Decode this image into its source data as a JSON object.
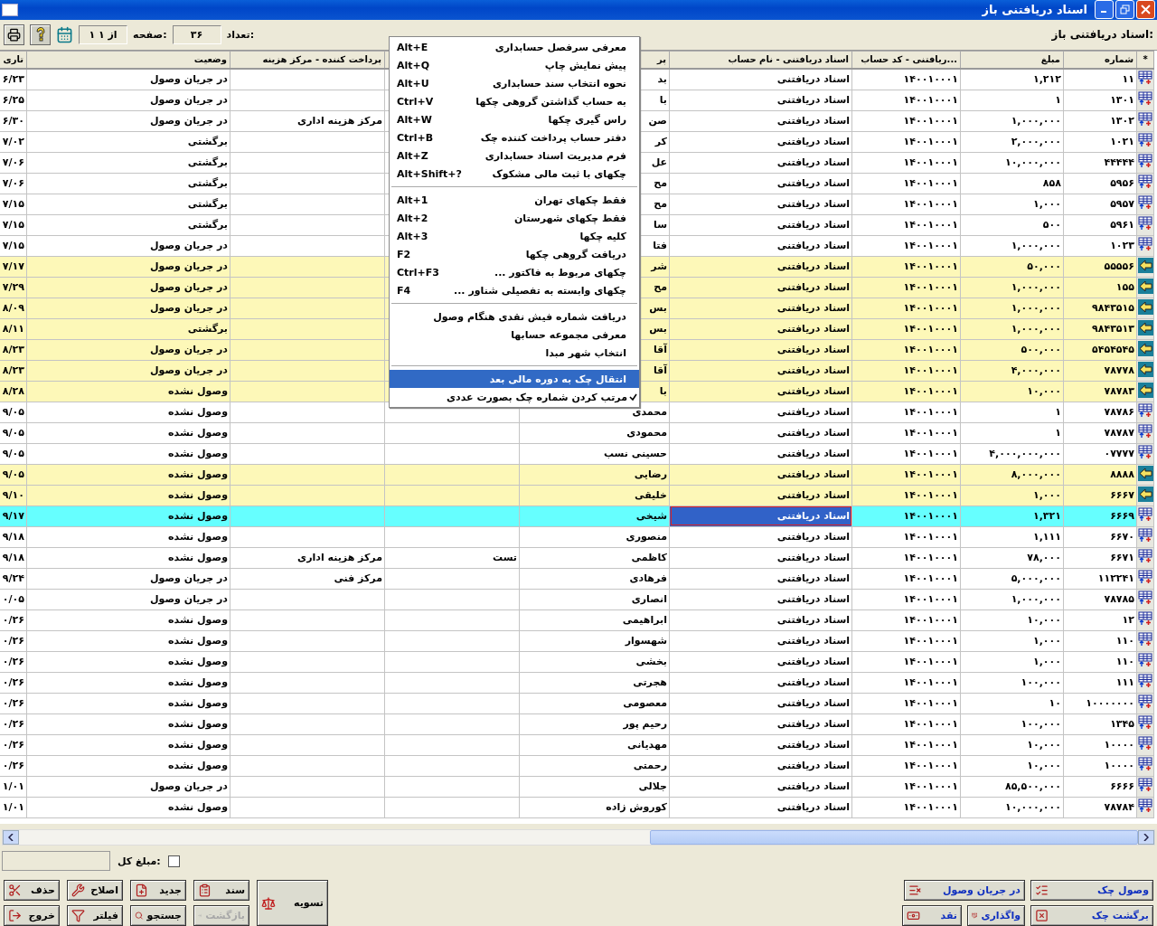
{
  "window": {
    "title": "اسناد دریافتنی باز"
  },
  "toolbar": {
    "heading": "اسناد دریافتنی باز:",
    "count_label": "تعداد:",
    "count": "۳۶",
    "page_label": "صفحه:",
    "page": "۱ از ۱"
  },
  "table": {
    "columns": [
      "*",
      "شماره",
      "مبلغ",
      "...ریافتنی - کد حساب",
      "اسناد دریافتنی - نام حساب",
      "پر",
      null,
      "پرداخت کننده - مرکز هزینه",
      "وضعیت",
      "تاری"
    ],
    "rows": [
      {
        "kind": "sheet",
        "selected": false,
        "number": "۱۱",
        "amount": "۱,۲۱۲",
        "account_code": "۱۴۰۰۱۰۰۰۱",
        "account_name": "اسناد دریافتنی",
        "column_5": "بد",
        "status": "در جریان وصول",
        "column_10": "۶/۲۳"
      },
      {
        "kind": "sheet",
        "selected": false,
        "number": "۱۳۰۱",
        "amount": "۱",
        "account_code": "۱۴۰۰۱۰۰۰۱",
        "account_name": "اسناد دریافتنی",
        "column_5": "با",
        "status": "در جریان وصول",
        "column_10": "۶/۲۵"
      },
      {
        "kind": "sheet",
        "selected": false,
        "number": "۱۳۰۲",
        "amount": "۱,۰۰۰,۰۰۰",
        "account_code": "۱۴۰۰۱۰۰۰۱",
        "account_name": "اسناد دریافتنی",
        "column_5": "صن",
        "cost_center": "مرکز هزینه اداری",
        "status": "در جریان وصول",
        "column_10": "۶/۳۰"
      },
      {
        "kind": "sheet",
        "selected": false,
        "number": "۱۰۲۱",
        "amount": "۲,۰۰۰,۰۰۰",
        "account_code": "۱۴۰۰۱۰۰۰۱",
        "account_name": "اسناد دریافتنی",
        "column_5": "کر",
        "status": "برگشتی",
        "column_10": "۷/۰۲"
      },
      {
        "kind": "sheet",
        "selected": false,
        "number": "۴۴۴۴۴",
        "amount": "۱۰,۰۰۰,۰۰۰",
        "account_code": "۱۴۰۰۱۰۰۰۱",
        "account_name": "اسناد دریافتنی",
        "column_5": "عل",
        "status": "برگشتی",
        "column_10": "۷/۰۶"
      },
      {
        "kind": "sheet",
        "selected": false,
        "number": "۵۹۵۶",
        "amount": "۸۵۸",
        "account_code": "۱۴۰۰۱۰۰۰۱",
        "account_name": "اسناد دریافتنی",
        "column_5": "مح",
        "status": "برگشتی",
        "column_10": "۷/۰۶"
      },
      {
        "kind": "sheet",
        "selected": false,
        "number": "۵۹۵۷",
        "amount": "۱,۰۰۰",
        "account_code": "۱۴۰۰۱۰۰۰۱",
        "account_name": "اسناد دریافتنی",
        "column_5": "مح",
        "status": "برگشتی",
        "column_10": "۷/۱۵"
      },
      {
        "kind": "sheet",
        "selected": false,
        "number": "۵۹۶۱",
        "amount": "۵۰۰",
        "account_code": "۱۴۰۰۱۰۰۰۱",
        "account_name": "اسناد دریافتنی",
        "column_5": "سا",
        "status": "برگشتی",
        "column_10": "۷/۱۵"
      },
      {
        "kind": "sheet",
        "selected": false,
        "number": "۱۰۲۳",
        "amount": "۱,۰۰۰,۰۰۰",
        "account_code": "۱۴۰۰۱۰۰۰۱",
        "account_name": "اسناد دریافتنی",
        "column_5": "فتا",
        "status": "در جریان وصول",
        "column_10": "۷/۱۵"
      },
      {
        "kind": "arrow",
        "selected": false,
        "number": "۵۵۵۵۶",
        "amount": "۵۰,۰۰۰",
        "account_code": "۱۴۰۰۱۰۰۰۱",
        "account_name": "اسناد دریافتنی",
        "column_5": "شر",
        "status": "در جریان وصول",
        "column_10": "۷/۱۷"
      },
      {
        "kind": "arrow",
        "selected": false,
        "number": "۱۵۵",
        "amount": "۱,۰۰۰,۰۰۰",
        "account_code": "۱۴۰۰۱۰۰۰۱",
        "account_name": "اسناد دریافتنی",
        "column_5": "مح",
        "status": "در جریان وصول",
        "column_10": "۷/۲۹"
      },
      {
        "kind": "arrow",
        "selected": false,
        "number": "۹۸۴۳۵۱۵",
        "amount": "۱,۰۰۰,۰۰۰",
        "account_code": "۱۴۰۰۱۰۰۰۱",
        "account_name": "اسناد دریافتنی",
        "column_5": "بس",
        "status": "در جریان وصول",
        "column_10": "۸/۰۹"
      },
      {
        "kind": "arrow",
        "selected": false,
        "number": "۹۸۴۳۵۱۳",
        "amount": "۱,۰۰۰,۰۰۰",
        "account_code": "۱۴۰۰۱۰۰۰۱",
        "account_name": "اسناد دریافتنی",
        "column_5": "بس",
        "status": "برگشتی",
        "column_10": "۸/۱۱"
      },
      {
        "kind": "arrow",
        "selected": false,
        "number": "۵۴۵۴۵۴۵",
        "amount": "۵۰۰,۰۰۰",
        "account_code": "۱۴۰۰۱۰۰۰۱",
        "account_name": "اسناد دریافتنی",
        "column_5": "آقا",
        "status": "در جریان وصول",
        "column_10": "۸/۲۳"
      },
      {
        "kind": "arrow",
        "selected": false,
        "number": "۷۸۷۷۸",
        "amount": "۴,۰۰۰,۰۰۰",
        "account_code": "۱۴۰۰۱۰۰۰۱",
        "account_name": "اسناد دریافتنی",
        "column_5": "آقا",
        "status": "در جریان وصول",
        "column_10": "۸/۲۳"
      },
      {
        "kind": "arrow",
        "selected": false,
        "number": "۷۸۷۸۳",
        "amount": "۱۰,۰۰۰",
        "account_code": "۱۴۰۰۱۰۰۰۱",
        "account_name": "اسناد دریافتنی",
        "column_5": "با",
        "status": "وصول نشده",
        "column_10": "۸/۲۸"
      },
      {
        "kind": "sheet",
        "selected": false,
        "number": "۷۸۷۸۶",
        "amount": "۱",
        "account_code": "۱۴۰۰۱۰۰۰۱",
        "account_name": "اسناد دریافتنی",
        "column_5": "محمدی",
        "status": "وصول نشده",
        "column_10": "۹/۰۵"
      },
      {
        "kind": "sheet",
        "selected": false,
        "number": "۷۸۷۸۷",
        "amount": "۱",
        "account_code": "۱۴۰۰۱۰۰۰۱",
        "account_name": "اسناد دریافتنی",
        "column_5": "محمودی",
        "status": "وصول نشده",
        "column_10": "۹/۰۵"
      },
      {
        "kind": "sheet",
        "selected": false,
        "number": "۰۷۷۷۷",
        "amount": "۴,۰۰۰,۰۰۰,۰۰۰",
        "account_code": "۱۴۰۰۱۰۰۰۱",
        "account_name": "اسناد دریافتنی",
        "column_5": "حسینی نسب",
        "status": "وصول نشده",
        "column_10": "۹/۰۵"
      },
      {
        "kind": "arrow",
        "selected": false,
        "number": "۸۸۸۸",
        "amount": "۸,۰۰۰,۰۰۰",
        "account_code": "۱۴۰۰۱۰۰۰۱",
        "account_name": "اسناد دریافتنی",
        "column_5": "رضایی",
        "status": "وصول نشده",
        "column_10": "۹/۰۵"
      },
      {
        "kind": "arrow",
        "selected": false,
        "number": "۶۶۶۷",
        "amount": "۱,۰۰۰",
        "account_code": "۱۴۰۰۱۰۰۰۱",
        "account_name": "اسناد دریافتنی",
        "column_5": "خلیقی",
        "status": "وصول نشده",
        "column_10": "۹/۱۰"
      },
      {
        "kind": "sheet",
        "selected": true,
        "cell_focused": true,
        "number": "۶۶۶۹",
        "amount": "۱,۳۲۱",
        "account_code": "۱۴۰۰۱۰۰۰۱",
        "account_name": "اسناد دریافتنی",
        "column_5": "شیخی",
        "status": "وصول نشده",
        "column_10": "۹/۱۷"
      },
      {
        "kind": "sheet",
        "selected": false,
        "number": "۶۶۷۰",
        "amount": "۱,۱۱۱",
        "account_code": "۱۴۰۰۱۰۰۰۱",
        "account_name": "اسناد دریافتنی",
        "column_5": "منصوری",
        "status": "وصول نشده",
        "column_10": "۹/۱۸"
      },
      {
        "kind": "sheet",
        "selected": false,
        "number": "۶۶۷۱",
        "amount": "۷۸,۰۰۰",
        "account_code": "۱۴۰۰۱۰۰۰۱",
        "account_name": "اسناد دریافتنی",
        "column_5": "کاظمی",
        "column_6": "تست",
        "cost_center": "مرکز هزینه اداری",
        "status": "وصول نشده",
        "column_10": "۹/۱۸"
      },
      {
        "kind": "sheet",
        "selected": false,
        "number": "۱۱۲۲۴۱",
        "amount": "۵,۰۰۰,۰۰۰",
        "account_code": "۱۴۰۰۱۰۰۰۱",
        "account_name": "اسناد دریافتنی",
        "column_5": "فرهادی",
        "cost_center": "مرکز فنی",
        "status": "در جریان وصول",
        "column_10": "۹/۲۴"
      },
      {
        "kind": "sheet",
        "selected": false,
        "number": "۷۸۷۸۵",
        "amount": "۱,۰۰۰,۰۰۰",
        "account_code": "۱۴۰۰۱۰۰۰۱",
        "account_name": "اسناد دریافتنی",
        "column_5": "انصاری",
        "status": "در جریان وصول",
        "column_10": "۰/۰۵"
      },
      {
        "kind": "sheet",
        "selected": false,
        "number": "۱۲",
        "amount": "۱۰,۰۰۰",
        "account_code": "۱۴۰۰۱۰۰۰۱",
        "account_name": "اسناد دریافتنی",
        "column_5": "ابراهیمی",
        "status": "وصول نشده",
        "column_10": "۰/۲۶"
      },
      {
        "kind": "sheet",
        "selected": false,
        "number": "۱۱۰",
        "amount": "۱,۰۰۰",
        "account_code": "۱۴۰۰۱۰۰۰۱",
        "account_name": "اسناد دریافتنی",
        "column_5": "شهسوار",
        "status": "وصول نشده",
        "column_10": "۰/۲۶"
      },
      {
        "kind": "sheet",
        "selected": false,
        "number": "۱۱۰",
        "amount": "۱,۰۰۰",
        "account_code": "۱۴۰۰۱۰۰۰۱",
        "account_name": "اسناد دریافتنی",
        "column_5": "بخشی",
        "status": "وصول نشده",
        "column_10": "۰/۲۶"
      },
      {
        "kind": "sheet",
        "selected": false,
        "number": "۱۱۱",
        "amount": "۱۰۰,۰۰۰",
        "account_code": "۱۴۰۰۱۰۰۰۱",
        "account_name": "اسناد دریافتنی",
        "column_5": "هجرتی",
        "status": "وصول نشده",
        "column_10": "۰/۲۶"
      },
      {
        "kind": "sheet",
        "selected": false,
        "number": "۱۰۰۰۰۰۰۰",
        "amount": "۱۰",
        "account_code": "۱۴۰۰۱۰۰۰۱",
        "account_name": "اسناد دریافتنی",
        "column_5": "معصومی",
        "status": "وصول نشده",
        "column_10": "۰/۲۶"
      },
      {
        "kind": "sheet",
        "selected": false,
        "number": "۱۳۴۵",
        "amount": "۱۰۰,۰۰۰",
        "account_code": "۱۴۰۰۱۰۰۰۱",
        "account_name": "اسناد دریافتنی",
        "column_5": "رحیم پور",
        "status": "وصول نشده",
        "column_10": "۰/۲۶"
      },
      {
        "kind": "sheet",
        "selected": false,
        "number": "۱۰۰۰۰",
        "amount": "۱۰,۰۰۰",
        "account_code": "۱۴۰۰۱۰۰۰۱",
        "account_name": "اسناد دریافتنی",
        "column_5": "مهدیانی",
        "status": "وصول نشده",
        "column_10": "۰/۲۶"
      },
      {
        "kind": "sheet",
        "selected": false,
        "number": "۱۰۰۰۰",
        "amount": "۱۰,۰۰۰",
        "account_code": "۱۴۰۰۱۰۰۰۱",
        "account_name": "اسناد دریافتنی",
        "column_5": "رحمتی",
        "status": "وصول نشده",
        "column_10": "۰/۲۶"
      },
      {
        "kind": "sheet",
        "selected": false,
        "number": "۶۶۶۶",
        "amount": "۸۵,۵۰۰,۰۰۰",
        "account_code": "۱۴۰۰۱۰۰۰۱",
        "account_name": "اسناد دریافتنی",
        "column_5": "جلالی",
        "status": "در جریان وصول",
        "column_10": "۱/۰۱"
      },
      {
        "kind": "sheet",
        "selected": false,
        "number": "۷۸۷۸۴",
        "amount": "۱۰,۰۰۰,۰۰۰",
        "account_code": "۱۴۰۰۱۰۰۰۱",
        "account_name": "اسناد دریافتنی",
        "column_5": "کوروش زاده",
        "status": "وصول نشده",
        "column_10": "۱/۰۱"
      }
    ]
  },
  "context_menu": {
    "groups": [
      [
        {
          "label": "معرفی سرفصل حسابداری",
          "shortcut": "Alt+E",
          "selected": false,
          "checked": false
        },
        {
          "label": "پیش نمایش چاپ",
          "shortcut": "Alt+Q",
          "selected": false,
          "checked": false
        },
        {
          "label": "نحوه انتخاب سند حسابداری",
          "shortcut": "Alt+U",
          "selected": false,
          "checked": false
        },
        {
          "label": "به حساب گذاشتن گروهی چکها",
          "shortcut": "Ctrl+V",
          "selected": false,
          "checked": false
        },
        {
          "label": "راس گیری چکها",
          "shortcut": "Alt+W",
          "selected": false,
          "checked": false
        },
        {
          "label": "دفتر حساب پرداخت کننده چک",
          "shortcut": "Ctrl+B",
          "selected": false,
          "checked": false
        },
        {
          "label": "فرم مدیریت اسناد حسابداری",
          "shortcut": "Alt+Z",
          "selected": false,
          "checked": false
        },
        {
          "label": "چکهای با ثبت مالی مشکوک",
          "shortcut": "Alt+Shift+?",
          "selected": false,
          "checked": false
        }
      ],
      [
        {
          "label": "فقط چکهای تهران",
          "shortcut": "Alt+1",
          "selected": false,
          "checked": false
        },
        {
          "label": "فقط چکهای شهرستان",
          "shortcut": "Alt+2",
          "selected": false,
          "checked": false
        },
        {
          "label": "کلیه چکها",
          "shortcut": "Alt+3",
          "selected": false,
          "checked": false
        },
        {
          "label": "دریافت گروهی چکها",
          "shortcut": "F2",
          "selected": false,
          "checked": false
        },
        {
          "label": "چکهای مربوط به فاکتور ...",
          "shortcut": "Ctrl+F3",
          "selected": false,
          "checked": false
        },
        {
          "label": "چکهای وابسته به تفصیلی شناور ...",
          "shortcut": "F4",
          "selected": false,
          "checked": false
        }
      ],
      [
        {
          "label": "دریافت شماره فیش نقدی هنگام وصول",
          "selected": false,
          "checked": false
        },
        {
          "label": "معرفی مجموعه حسابها",
          "selected": false,
          "checked": false
        },
        {
          "label": "انتخاب شهر مبدا",
          "selected": false,
          "checked": false
        }
      ],
      [
        {
          "label": "انتقال چک به دوره مالی بعد",
          "selected": true,
          "checked": false
        },
        {
          "label": "مرتب کردن شماره چک بصورت عددی",
          "selected": false,
          "checked": true
        }
      ]
    ]
  },
  "total": {
    "label": "مبلغ کل:",
    "checked": false
  },
  "actions_left": {
    "row_1": [
      {
        "label": "سند",
        "disabled": false
      },
      {
        "label": "جدید",
        "disabled": false
      },
      {
        "label": "اصلاح",
        "disabled": false
      },
      {
        "label": "حذف",
        "disabled": false
      }
    ],
    "row_2": [
      {
        "label": "بازگشت",
        "disabled": true
      },
      {
        "label": "جستجو",
        "disabled": false
      },
      {
        "label": "فیلتر",
        "disabled": false
      },
      {
        "label": "خروج",
        "disabled": false
      }
    ],
    "settle": {
      "label": "تسویه",
      "disabled": false
    }
  },
  "actions_right": {
    "row_1": [
      {
        "label": "وصول چک",
        "disabled": false
      },
      {
        "label": "در جریان وصول",
        "disabled": false
      }
    ],
    "row_2": [
      {
        "label": "برگشت چک",
        "disabled": false
      },
      {
        "label": "واگذاری",
        "disabled": false
      },
      {
        "label": "نقد",
        "disabled": false
      }
    ]
  }
}
